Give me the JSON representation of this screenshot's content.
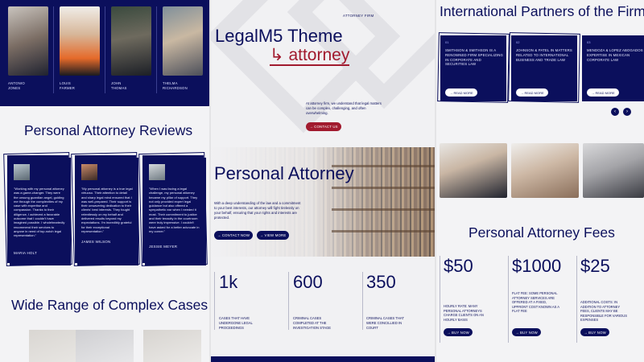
{
  "team": [
    {
      "first": "ANTONIO",
      "last": "JONES"
    },
    {
      "first": "LOUIS",
      "last": "FARMER"
    },
    {
      "first": "JOHN",
      "last": "THOMAS"
    },
    {
      "first": "THELMA",
      "last": "RICHARDSON"
    }
  ],
  "reviews": {
    "title": "Personal Attorney Reviews",
    "items": [
      {
        "quote": "\"Working with my personal attorney was a game-changer. They were the unsung guardian angel, guiding me through the complexities of my case with expertise and compassion. Thanks to their diligence, I achieved a favorable outcome that I couldn't have imagined possible. I wholeheartedly recommend their services to anyone in need of top-notch legal representation.\"",
        "author": "MARIA HOLT"
      },
      {
        "quote": "\"My personal attorney is a true legal virtuoso. Their attention to detail and sharp legal mind ensured that I was well-prepared. Their support is their unwavering dedication to their clients' best interests. They fought relentlessly on my behalf and delivered results beyond my expectations. I'm incredibly grateful for their exceptional representation.\"",
        "author": "JAMES WILSON"
      },
      {
        "quote": "\"When I was facing a legal challenge, my personal attorney became my pillar of support. They not only provided expert legal guidance but also offered a sympathetic ear when I needed it most. Their commitment to justice and their tenacity in the courtroom were truly impressive. I couldn't have asked for a better advocate in my corner.\"",
        "author": "JESSIE MEYER"
      }
    ]
  },
  "cases": {
    "title": "Wide Range of Complex Cases"
  },
  "hero": {
    "tag": "ATTORNEY FIRM",
    "title": "LegalM5 Theme",
    "subtitle": "attorney",
    "arrow": "↳",
    "intro": "At attorney firm, we understand that legal matters can be complex, challenging, and often overwhelming.",
    "cta": "CONTACT US"
  },
  "personal": {
    "title": "Personal Attorney",
    "text": "With a deep understanding of the law and a commitment to your best interests, our attorney will fight tirelessly on your behalf, ensuring that your rights and interests are protected.",
    "contact": "CONTACT NOW",
    "view": "VIEW MORE"
  },
  "stats": [
    {
      "num": "1k",
      "label": "CASES THAT HAVE UNDERGONE LEGAL PROCEEDINGS"
    },
    {
      "num": "600",
      "label": "CRIMINAL CASES COMPLETED AT THE INVESTIGATION STAGE"
    },
    {
      "num": "350",
      "label": "CRIMINAL CASES THAT WERE CONCILLIED IN COURT"
    }
  ],
  "partners": {
    "title": "International Partners of the Firm",
    "items": [
      {
        "idx": "01",
        "text": "SMITHSON & SMITHSON IS A RENOWNED FIRM SPECIALIZING IN CORPORATE AND SECURITIES LAW",
        "btn": "READ MORE"
      },
      {
        "idx": "02",
        "text": "JOHNSON & PATEL IN MATTERS RELATED TO INTERNATIONAL BUSINESS AND TRADE LAW",
        "btn": "READ MORE"
      },
      {
        "idx": "03",
        "text": "MENDOZA & LOPEZ ABOGADOS EXPERTISE IN MEXICAN CORPORATE LAW",
        "btn": "READ MORE"
      }
    ]
  },
  "fees": {
    "title": "Personal Attorney Fees",
    "items": [
      {
        "price": "$50",
        "text": "HOURLY RATE: MANY PERSONAL ATTORNEYS CHARGE CLIENTS ON AN HOURLY BASIS",
        "btn": "BUY NOW"
      },
      {
        "price": "$1000",
        "text": "FLAT FEE: SOME PERSONAL ATTORNEY SERVICES ARE OFFERED AT A FIXED, UPFRONT COST KNOWN AS A FLAT FEE",
        "btn": "BUY NOW"
      },
      {
        "price": "$25",
        "text": "ADDITIONAL COSTS: IN ADDITION TO ATTORNEY FEES, CLIENTS MAY BE RESPONSIBLE FOR VARIOUS EXPENSES",
        "btn": "BUY NOW"
      }
    ]
  },
  "icons": {
    "arrow": "arrow-right-icon",
    "prev": "chevron-left-icon",
    "next": "chevron-right-icon",
    "quote": "quote-icon"
  },
  "colors": {
    "navy": "#0b0f5c",
    "red": "#a11a2e",
    "bg": "#f3f3f5"
  }
}
